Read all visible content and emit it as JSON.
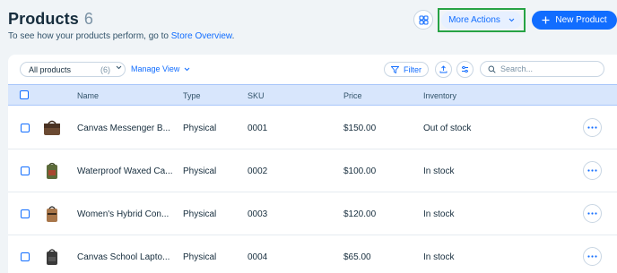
{
  "header": {
    "title": "Products",
    "count": "6",
    "subtitle_prefix": "To see how your products perform, go to ",
    "subtitle_link": "Store Overview",
    "subtitle_suffix": ".",
    "more_actions_label": "More Actions",
    "new_product_label": "New Product"
  },
  "toolbar": {
    "view_select": "All products",
    "view_count": "(6)",
    "manage_view_label": "Manage View",
    "filter_label": "Filter",
    "search_placeholder": "Search..."
  },
  "columns": [
    "Name",
    "Type",
    "SKU",
    "Price",
    "Inventory"
  ],
  "rows": [
    {
      "name": "Canvas Messenger B...",
      "type": "Physical",
      "sku": "0001",
      "price": "$150.00",
      "inventory": "Out of stock",
      "thumb_color": "#6b4a32"
    },
    {
      "name": "Waterproof Waxed Ca...",
      "type": "Physical",
      "sku": "0002",
      "price": "$100.00",
      "inventory": "In stock",
      "thumb_color": "#5c6b3a"
    },
    {
      "name": "Women's Hybrid Con...",
      "type": "Physical",
      "sku": "0003",
      "price": "$120.00",
      "inventory": "In stock",
      "thumb_color": "#a8764a"
    },
    {
      "name": "Canvas School Lapto...",
      "type": "Physical",
      "sku": "0004",
      "price": "$65.00",
      "inventory": "In stock",
      "thumb_color": "#3a3a3a"
    }
  ],
  "icons": {
    "top_icon": "layout-icon",
    "export": "upload-icon",
    "settings": "sliders-icon",
    "search": "search-icon",
    "row_actions": "more-horizontal-icon"
  },
  "colors": {
    "accent": "#116dff",
    "highlight_border": "#27a344",
    "header_row": "#d8e6fc",
    "background": "#f0f4f7"
  }
}
